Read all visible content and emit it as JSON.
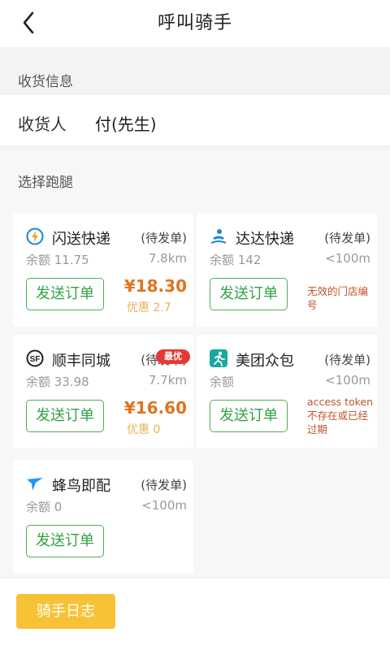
{
  "header": {
    "title": "呼叫骑手"
  },
  "receiver_section": {
    "title": "收货信息",
    "label": "收货人",
    "name": "付(先生)"
  },
  "runner_section": {
    "title": "选择跑腿"
  },
  "couriers": [
    {
      "name": "闪送快递",
      "status": "(待发单)",
      "balance": "余额 11.75",
      "distance": "7.8km",
      "send_label": "发送订单",
      "price": "¥18.30",
      "discount": "优惠 2.7",
      "icon": "lightning-circle-icon"
    },
    {
      "name": "达达快递",
      "status": "(待发单)",
      "balance": "余额 142",
      "distance": "<100m",
      "send_label": "发送订单",
      "error": "无效的门店编号",
      "icon": "dada-runner-icon"
    },
    {
      "name": "顺丰同城",
      "status": "(待发单)",
      "balance": "余额 33.98",
      "distance": "7.7km",
      "send_label": "发送订单",
      "price": "¥16.60",
      "discount": "优惠 0",
      "badge": "最优",
      "icon": "sf-logo-icon"
    },
    {
      "name": "美团众包",
      "status": "(待发单)",
      "balance": "余额",
      "distance": "<100m",
      "send_label": "发送订单",
      "error": "access token 不存在或已经过期",
      "icon": "meituan-runner-icon"
    },
    {
      "name": "蜂鸟即配",
      "status": "(待发单)",
      "balance": "余额 0",
      "distance": "<100m",
      "send_label": "发送订单",
      "icon": "hummingbird-icon"
    }
  ],
  "footer": {
    "log_button": "骑手日志"
  },
  "colors": {
    "accent_green": "#33a244",
    "price_orange": "#e0731f",
    "discount_gold": "#e6b35a",
    "error_red": "#c0542a",
    "log_button_yellow": "#f7c236"
  }
}
